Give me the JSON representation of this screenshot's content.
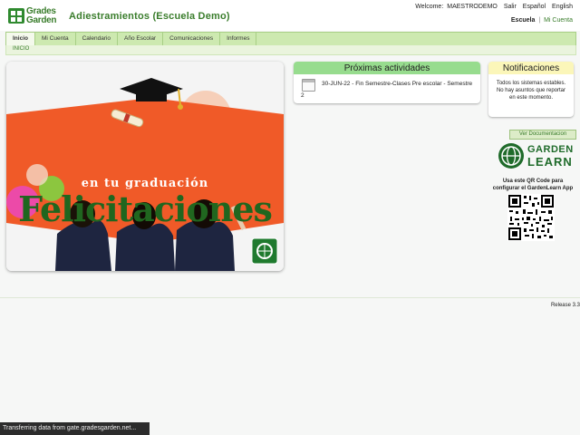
{
  "logo": {
    "line1": "Grades",
    "line2": "Garden"
  },
  "app_title": "Adiestramientos (Escuela Demo)",
  "user": {
    "welcome": "Welcome:",
    "name": "MAESTRODEMO",
    "logout": "Salir",
    "lang_es": "Español",
    "lang_en": "English"
  },
  "school_nav": {
    "school": "Escuela",
    "separator": "|",
    "my_account": "Mi Cuenta"
  },
  "nav": {
    "tabs": [
      {
        "label": "Inicio"
      },
      {
        "label": "Mi Cuenta"
      },
      {
        "label": "Calendario"
      },
      {
        "label": "Año Escolar"
      },
      {
        "label": "Comunicaciones"
      },
      {
        "label": "Informes"
      }
    ],
    "active": "Inicio",
    "breadcrumb": "INICIO"
  },
  "banner": {
    "title": "Felicitaciones",
    "subtitle": "en tu graduación"
  },
  "activities": {
    "title": "Próximas actividades",
    "items": [
      {
        "line1": "30-JUN-22 - Fin Semestre-Clases Pre escolar - Semestre",
        "line2": "2"
      }
    ]
  },
  "notifications": {
    "title": "Notificaciones",
    "message": "Todos los sistemas estables. No hay asuntos que reportar en este momento."
  },
  "documentation_button": "Ver Documentacion",
  "gardenlearn": {
    "line1": "GARDEN",
    "line2": "LEARN",
    "qr_caption": "Usa este QR Code para configurar el GardenLearn App"
  },
  "footer": {
    "release": "Release 3.3"
  },
  "status_bar": "Transferring data from gate.gradesgarden.net...",
  "colors": {
    "brand_green": "#3a7d2c",
    "nav_bg": "#cde9b0",
    "activities_header": "#97dc8e",
    "notifications_header": "#fbf6b9",
    "banner_orange": "#f05a28"
  }
}
